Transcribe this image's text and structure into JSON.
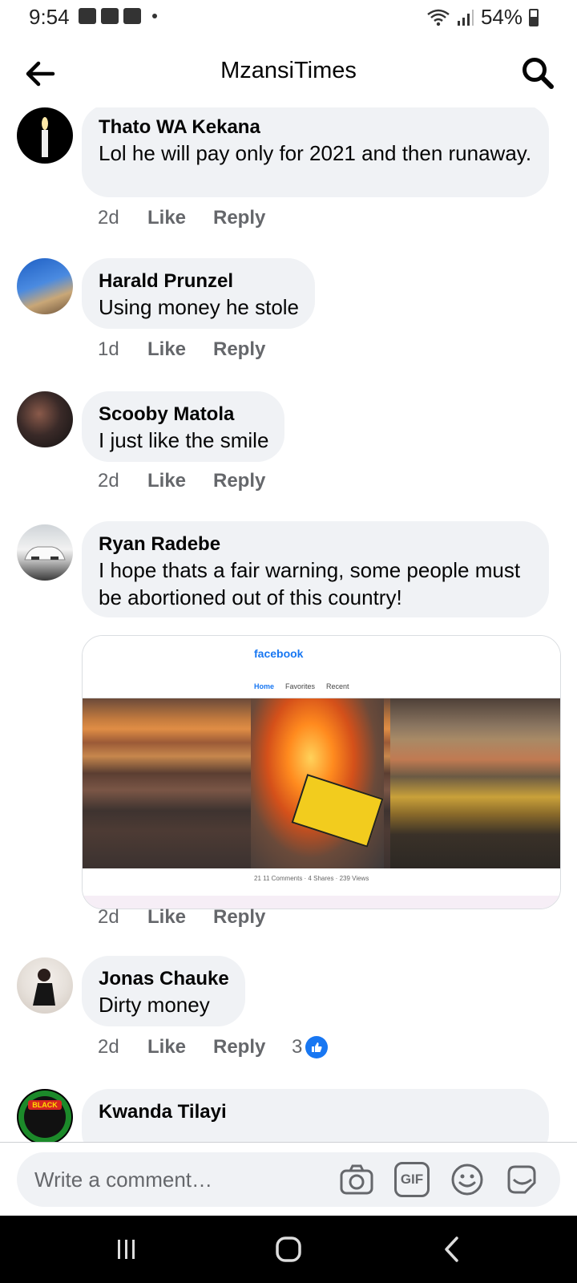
{
  "status_bar": {
    "time": "9:54",
    "battery": "54%"
  },
  "header": {
    "title": "MzansiTimes"
  },
  "comments": [
    {
      "name": "Thato WA Kekana",
      "text": "Lol he will pay only for 2021 and then runaway.",
      "time": "2d",
      "like": "Like",
      "reply": "Reply"
    },
    {
      "name": "Harald Prunzel",
      "text": "Using money he stole",
      "time": "1d",
      "like": "Like",
      "reply": "Reply"
    },
    {
      "name": "Scooby Matola",
      "text": "I just like the smile",
      "time": "2d",
      "like": "Like",
      "reply": "Reply"
    },
    {
      "name": "Ryan Radebe",
      "text": "I hope thats a fair warning, some people must be abortioned out of this country!",
      "time": "2d",
      "like": "Like",
      "reply": "Reply",
      "attachment": {
        "brand": "facebook",
        "tabs": [
          "Home",
          "Favorites",
          "Recent"
        ],
        "stats": "21  11 Comments · 4 Shares · 239 Views"
      }
    },
    {
      "name": "Jonas Chauke",
      "text": "Dirty money",
      "time": "2d",
      "like": "Like",
      "reply": "Reply",
      "reaction_count": "3"
    },
    {
      "name": "Kwanda Tilayi",
      "avatar_text": "BLACK"
    }
  ],
  "composer": {
    "placeholder": "Write a comment…",
    "gif_label": "GIF"
  },
  "colors": {
    "accent": "#1877f2",
    "bubble": "#f0f2f5",
    "meta": "#65676b"
  }
}
